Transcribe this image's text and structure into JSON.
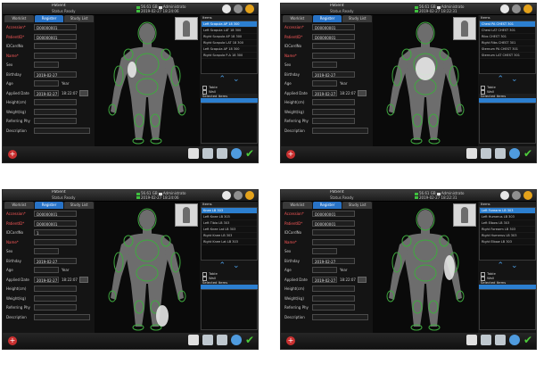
{
  "panels": [
    {
      "title": "Patient",
      "status_label": "Status",
      "status_value": "Ready",
      "info_line1": "56.61 GB",
      "info_line2": "2019-02-27 18:24:06",
      "admin_label": "Administrato",
      "tabs": [
        "Worklist",
        "Register",
        "Study List"
      ],
      "fields": {
        "accession_label": "Accession*",
        "accession_value": "D00000001",
        "patient_id_label": "PatientID*",
        "patient_id_value": "D00000001",
        "idcard_label": "IDCardNo",
        "idcard_value": "",
        "name_label": "Name*",
        "name_value": "",
        "sex_label": "Sex",
        "birthday_label": "Birthday",
        "birthday_value": "2019-02-27",
        "age_label": "Age",
        "age_unit": "Year",
        "applied_date_label": "Applied Date",
        "applied_date_value": "2019-02-27",
        "applied_time_value": "18:22:07",
        "height_label": "Height(cm)",
        "weight_label": "Weight(kg)",
        "referring_label": "Referring Phy",
        "description_label": "Description"
      },
      "items_header": "Items",
      "items": [
        "Left Scapula AP 18 300",
        "Left Scapula LAT 18 300",
        "Right Scapula AP 18 300",
        "Right Scapula LAT 18 300",
        "Left Scapula AP 18 300",
        "Right Scapula P-A 18 300"
      ],
      "selected_index": 0,
      "checkbox1": "Table",
      "checkbox2": "Wall",
      "selected_items_label": "Selected Items"
    },
    {
      "title": "Patient",
      "status_label": "Status",
      "status_value": "Ready",
      "info_line1": "56.61 GB",
      "info_line2": "2019-02-27 18:22:31",
      "admin_label": "Administrato",
      "tabs": [
        "Worklist",
        "Register",
        "Study List"
      ],
      "fields": {
        "accession_label": "Accession*",
        "accession_value": "D00000001",
        "patient_id_label": "PatientID*",
        "patient_id_value": "D00000001",
        "idcard_label": "IDCardNo",
        "idcard_value": "",
        "name_label": "Name*",
        "name_value": "",
        "sex_label": "Sex",
        "birthday_label": "Birthday",
        "birthday_value": "2019-02-27",
        "age_label": "Age",
        "age_unit": "Year",
        "applied_date_label": "Applied Date",
        "applied_date_value": "2019-02-27",
        "applied_time_value": "18:22:07",
        "height_label": "Height(cm)",
        "weight_label": "Weight(kg)",
        "referring_label": "Referring Phy",
        "description_label": "Description"
      },
      "items_header": "Items",
      "items": [
        "Chest PA CHEST 301",
        "Chest LAT CHEST 301",
        "Ribs CHEST 301",
        "Right Ribs CHEST 301",
        "Sternum PA CHEST 301",
        "Sternum LAT CHEST 301"
      ],
      "selected_index": 0,
      "checkbox1": "Table",
      "checkbox2": "Wall",
      "selected_items_label": "Selected Items"
    },
    {
      "title": "Patient",
      "status_label": "Status",
      "status_value": "Ready",
      "info_line1": "56.61 GB",
      "info_line2": "2019-02-27 18:24:06",
      "admin_label": "Administrato",
      "tabs": [
        "Worklist",
        "Register",
        "Study List"
      ],
      "fields": {
        "accession_label": "Accession*",
        "accession_value": "D00000001",
        "patient_id_label": "PatientID*",
        "patient_id_value": "D00000001",
        "idcard_label": "IDCardNo",
        "idcard_value": "1",
        "name_label": "Name*",
        "name_value": "",
        "sex_label": "Sex",
        "birthday_label": "Birthday",
        "birthday_value": "2019-02-27",
        "age_label": "Age",
        "age_unit": "Year",
        "applied_date_label": "Applied Date",
        "applied_date_value": "2019-02-27",
        "applied_time_value": "18:22:07",
        "height_label": "Height(cm)",
        "weight_label": "Weight(kg)",
        "referring_label": "Referring Phy",
        "description_label": "Description"
      },
      "items_header": "Items",
      "items": [
        "Knee LB 303",
        "Left Knee LB 303",
        "Left Tibia LB 303",
        "Left Knee Lat LB 303",
        "Right Knee LB 303",
        "Right Knee Lat LB 303"
      ],
      "selected_index": 0,
      "checkbox1": "Table",
      "checkbox2": "Wall",
      "selected_items_label": "Selected Items"
    },
    {
      "title": "Patient",
      "status_label": "Status",
      "status_value": "Ready",
      "info_line1": "56.61 GB",
      "info_line2": "2019-02-27 18:22:31",
      "admin_label": "Administrato",
      "tabs": [
        "Worklist",
        "Register",
        "Study List"
      ],
      "fields": {
        "accession_label": "Accession*",
        "accession_value": "D00000001",
        "patient_id_label": "PatientID*",
        "patient_id_value": "D00000001",
        "idcard_label": "IDCardNo",
        "idcard_value": "",
        "name_label": "Name*",
        "name_value": "",
        "sex_label": "Sex",
        "birthday_label": "Birthday",
        "birthday_value": "2019-02-27",
        "age_label": "Age",
        "age_unit": "Year",
        "applied_date_label": "Applied Date",
        "applied_date_value": "2019-02-27",
        "applied_time_value": "18:22:07",
        "height_label": "Height(cm)",
        "weight_label": "Weight(kg)",
        "referring_label": "Referring Phy",
        "description_label": "Description"
      },
      "items_header": "Items",
      "items": [
        "Left Forearm LB 303",
        "Left Humerus LB 303",
        "Left Elbow LB 303",
        "Right Forearm LB 303",
        "Right Humerus LB 303",
        "Right Elbow LB 303"
      ],
      "selected_index": 0,
      "checkbox1": "Table",
      "checkbox2": "Wall",
      "selected_items_label": "Selected Items"
    }
  ],
  "colors": {
    "accent": "#2c7fd0",
    "highlight": "#4ccb3a",
    "body": "#6d6d6d",
    "zone": "#3fa93f"
  }
}
